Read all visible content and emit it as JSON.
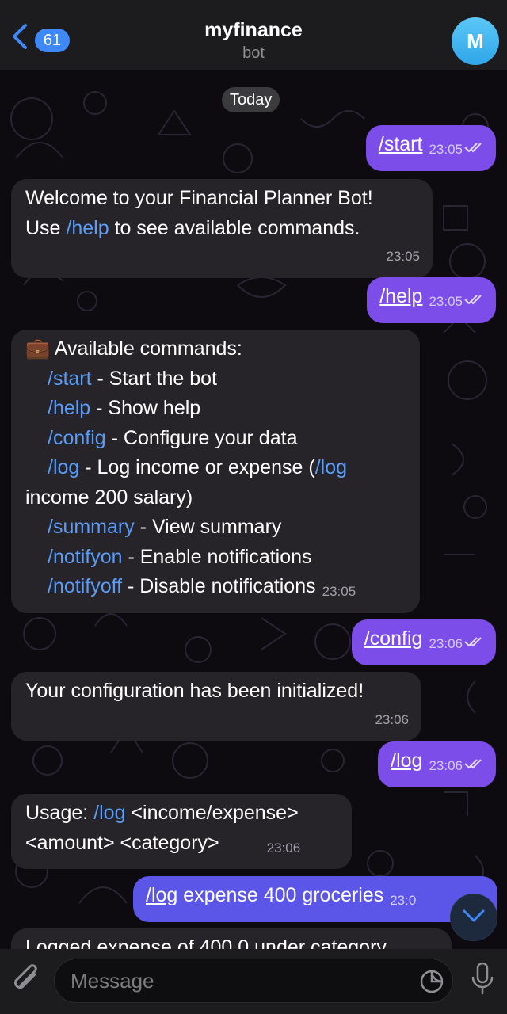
{
  "header": {
    "back_count": "61",
    "title": "myfinance",
    "subtitle": "bot",
    "avatar_letter": "M"
  },
  "chat": {
    "date_divider": "Today",
    "messages": [
      {
        "dir": "out",
        "cmd": "/start",
        "time": "23:05"
      },
      {
        "dir": "in",
        "line1": "Welcome to your Financial Planner Bot!",
        "line2_pre": "Use ",
        "line2_link": "/help",
        "line2_post": " to see available commands.",
        "time": "23:05"
      },
      {
        "dir": "out",
        "cmd": "/help",
        "time": "23:05"
      },
      {
        "dir": "in",
        "emoji": "💼",
        "heading": "Available commands:",
        "lines": [
          {
            "cmd": "/start",
            "desc": " - Start the bot"
          },
          {
            "cmd": "/help",
            "desc": " - Show help"
          },
          {
            "cmd": "/config",
            "desc": " - Configure your data"
          },
          {
            "cmd": "/log",
            "desc": " - Log income or expense (",
            "cmd2": "/log",
            "wrap": "income 200 salary)"
          },
          {
            "cmd": "/summary",
            "desc": " - View summary"
          },
          {
            "cmd": "/notifyon",
            "desc": " - Enable notifications"
          },
          {
            "cmd": "/notifyoff",
            "desc": " - Disable notifications"
          }
        ],
        "time": "23:05"
      },
      {
        "dir": "out",
        "cmd": "/config",
        "time": "23:06"
      },
      {
        "dir": "in",
        "text": "Your configuration has been initialized!",
        "time": "23:06"
      },
      {
        "dir": "out",
        "cmd": "/log",
        "time": "23:06"
      },
      {
        "dir": "in",
        "pre": "Usage: ",
        "link": "/log",
        "post": " <income/expense>",
        "line2": "<amount> <category>",
        "time": "23:06"
      },
      {
        "dir": "out",
        "cmd": "/log",
        "rest": " expense 400 groceries",
        "time": "23:0"
      },
      {
        "dir": "in",
        "text": "Logged expense of 400.0 under category"
      }
    ]
  },
  "input": {
    "placeholder": "Message"
  },
  "colors": {
    "accent": "#3e88f7",
    "outgoing": "#7c4de9",
    "incoming": "#262429",
    "link": "#5a9cf7"
  },
  "icons": [
    "chevron-left-icon",
    "double-check-icon",
    "chevron-down-icon",
    "paperclip-icon",
    "sticker-icon",
    "microphone-icon"
  ]
}
